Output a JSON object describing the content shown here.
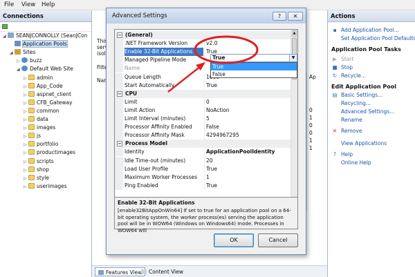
{
  "menu": [
    "File",
    "View",
    "Help"
  ],
  "connections": {
    "title": "Connections",
    "tree": [
      {
        "label": "SEANJCONNOLLY (SeanJCon",
        "level": 0,
        "expander": "◢",
        "icon": "computer-icon"
      },
      {
        "label": "Application Pools",
        "level": 1,
        "expander": "",
        "icon": "app-pools-icon",
        "selected": true
      },
      {
        "label": "Sites",
        "level": 1,
        "expander": "◢",
        "icon": "sites-icon"
      },
      {
        "label": "buzz",
        "level": 2,
        "expander": "▷",
        "icon": "globe-icon"
      },
      {
        "label": "Default Web Site",
        "level": 2,
        "expander": "◢",
        "icon": "globe-icon"
      },
      {
        "label": "admin",
        "level": 3,
        "expander": "▷",
        "icon": "folder-icon"
      },
      {
        "label": "App_Code",
        "level": 3,
        "expander": "▷",
        "icon": "folder-icon"
      },
      {
        "label": "aspnet_client",
        "level": 3,
        "expander": "▷",
        "icon": "folder-icon"
      },
      {
        "label": "CFB_Gateway",
        "level": 3,
        "expander": "▷",
        "icon": "folder-icon"
      },
      {
        "label": "common",
        "level": 3,
        "expander": "▷",
        "icon": "folder-icon"
      },
      {
        "label": "data",
        "level": 3,
        "expander": "▷",
        "icon": "folder-icon"
      },
      {
        "label": "images",
        "level": 3,
        "expander": "▷",
        "icon": "folder-icon"
      },
      {
        "label": "js",
        "level": 3,
        "expander": "▷",
        "icon": "folder-icon"
      },
      {
        "label": "portfolio",
        "level": 3,
        "expander": "▷",
        "icon": "folder-icon"
      },
      {
        "label": "productimages",
        "level": 3,
        "expander": "▷",
        "icon": "folder-icon"
      },
      {
        "label": "scripts",
        "level": 3,
        "expander": "▷",
        "icon": "folder-icon"
      },
      {
        "label": "shop",
        "level": 3,
        "expander": "▷",
        "icon": "folder-icon"
      },
      {
        "label": "style",
        "level": 3,
        "expander": "▷",
        "icon": "folder-icon"
      },
      {
        "label": "userimages",
        "level": 3,
        "expander": "▷",
        "icon": "folder-icon"
      }
    ]
  },
  "middle": {
    "partial_text": [
      "This",
      "serv",
      "isola"
    ],
    "filter_label": "Filte",
    "name_col": "Nar",
    "list_col_header": "Ap",
    "list_col_values": [
      "0",
      "1",
      "0",
      "0",
      "1",
      "1"
    ],
    "tabs": [
      "Features View",
      "Content View"
    ]
  },
  "actions": {
    "title": "Actions",
    "items": [
      {
        "label": "Add Application Pool...",
        "kind": "link",
        "icon": "add-pool-icon",
        "glyph": "▪"
      },
      {
        "label": "Set Application Pool Defaults...",
        "kind": "link",
        "icon": "",
        "glyph": ""
      },
      {
        "label": "Application Pool Tasks",
        "kind": "section",
        "icon": "",
        "glyph": ""
      },
      {
        "label": "Start",
        "kind": "disabled",
        "icon": "start-icon",
        "glyph": "▶"
      },
      {
        "label": "Stop",
        "kind": "link",
        "icon": "stop-icon",
        "glyph": "■"
      },
      {
        "label": "Recycle...",
        "kind": "link",
        "icon": "recycle-icon",
        "glyph": "↻"
      },
      {
        "label": "Edit Application Pool",
        "kind": "section",
        "icon": "",
        "glyph": ""
      },
      {
        "label": "Basic Settings...",
        "kind": "link",
        "icon": "settings-icon",
        "glyph": "▤"
      },
      {
        "label": "Recycling...",
        "kind": "link",
        "icon": "",
        "glyph": ""
      },
      {
        "label": "Advanced Settings...",
        "kind": "link",
        "icon": "",
        "glyph": ""
      },
      {
        "label": "Rename",
        "kind": "link",
        "icon": "",
        "glyph": ""
      },
      {
        "label": "Remove",
        "kind": "link",
        "icon": "remove-icon",
        "glyph": "✕"
      },
      {
        "label": "View Applications",
        "kind": "link",
        "icon": "",
        "glyph": ""
      },
      {
        "label": "Help",
        "kind": "link",
        "icon": "help-icon",
        "glyph": "?"
      },
      {
        "label": "Online Help",
        "kind": "link",
        "icon": "",
        "glyph": ""
      }
    ]
  },
  "dialog": {
    "title": "Advanced Settings",
    "help_glyph": "?",
    "close_glyph": "✕",
    "rows": [
      {
        "type": "cat",
        "label": "(General)",
        "toggle": "⊟"
      },
      {
        "type": "prop",
        "name": ".NET Framework Version",
        "value": "v2.0"
      },
      {
        "type": "prop",
        "name": "Enable 32-Bit Applications",
        "value": "True",
        "selected": true
      },
      {
        "type": "prop",
        "name": "Managed Pipeline Mode",
        "value": ""
      },
      {
        "type": "prop",
        "name": "Name",
        "value": "",
        "disabled": true
      },
      {
        "type": "prop",
        "name": "Queue Length",
        "value": "1000"
      },
      {
        "type": "prop",
        "name": "Start Automatically",
        "value": "True"
      },
      {
        "type": "cat",
        "label": "CPU",
        "toggle": "⊟"
      },
      {
        "type": "prop",
        "name": "Limit",
        "value": "0"
      },
      {
        "type": "prop",
        "name": "Limit Action",
        "value": "NoAction"
      },
      {
        "type": "prop",
        "name": "Limit Interval (minutes)",
        "value": "5"
      },
      {
        "type": "prop",
        "name": "Processor Affinity Enabled",
        "value": "False"
      },
      {
        "type": "prop",
        "name": "Processor Affinity Mask",
        "value": "4294967295"
      },
      {
        "type": "cat",
        "label": "Process Model",
        "toggle": "⊟"
      },
      {
        "type": "prop",
        "name": "Identity",
        "value": "ApplicationPoolIdentity",
        "bold": true
      },
      {
        "type": "prop",
        "name": "Idle Time-out (minutes)",
        "value": "20"
      },
      {
        "type": "prop",
        "name": "Load User Profile",
        "value": "True"
      },
      {
        "type": "prop",
        "name": "Maximum Worker Processes",
        "value": "1"
      },
      {
        "type": "prop",
        "name": "Ping Enabled",
        "value": "True"
      }
    ],
    "dropdown": {
      "selected": "True",
      "options": [
        "True",
        "False"
      ],
      "highlighted": 0
    },
    "description": {
      "title": "Enable 32-Bit Applications",
      "body": "[enable32BitAppOnWin64] If set to true for an application pool on a 64-bit operating system, the worker process(es) serving the application pool will be in WOW64 (Windows on Windows64) mode. Processes in WOW64 will"
    },
    "ok_label": "OK",
    "cancel_label": "Cancel"
  },
  "annotation_color": "#e02020"
}
